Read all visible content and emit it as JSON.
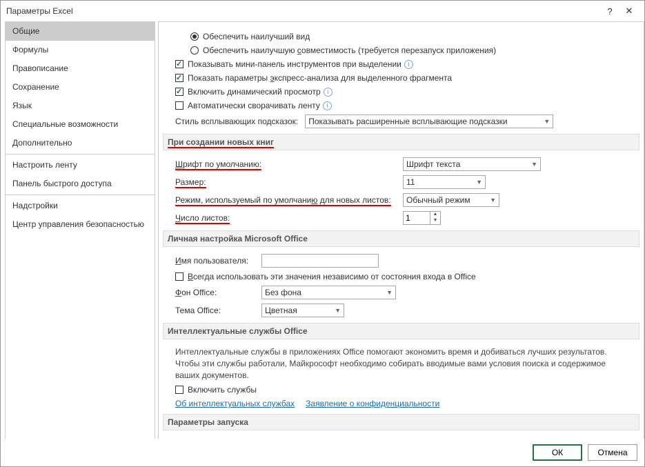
{
  "title": "Параметры Excel",
  "sidebar": {
    "items": [
      {
        "label": "Общие",
        "selected": true
      },
      {
        "label": "Формулы"
      },
      {
        "label": "Правописание"
      },
      {
        "label": "Сохранение"
      },
      {
        "label": "Язык"
      },
      {
        "label": "Специальные возможности"
      },
      {
        "label": "Дополнительно"
      },
      {
        "label": "Настроить ленту",
        "sep": true
      },
      {
        "label": "Панель быстрого доступа"
      },
      {
        "label": "Надстройки",
        "sep": true
      },
      {
        "label": "Центр управления безопасностью"
      }
    ]
  },
  "radios": {
    "best_view": "Обеспечить наилучший вид",
    "best_compat": "Обеспечить наилучшую совместимость (требуется перезапуск приложения)"
  },
  "checks": {
    "mini_toolbar": "Показывать мини-панель инструментов при выделении",
    "quick_analysis": "Показать параметры экспресс-анализа для выделенного фрагмента",
    "live_preview": "Включить динамический просмотр",
    "collapse_ribbon": "Автоматически сворачивать ленту"
  },
  "tooltip_label": "Стиль всплывающих подсказок:",
  "tooltip_value": "Показывать расширенные всплывающие подсказки",
  "sec_newbook": "При создании новых книг",
  "newbook": {
    "font_label": "Шрифт по умолчанию:",
    "font_value": "Шрифт текста",
    "size_label": "Размер:",
    "size_value": "11",
    "mode_label": "Режим, используемый по умолчанию для новых листов:",
    "mode_value": "Обычный режим",
    "sheets_label": "Число листов:",
    "sheets_value": "1"
  },
  "sec_personal": "Личная настройка Microsoft Office",
  "personal": {
    "username_label": "Имя пользователя:",
    "always_use": "Всегда использовать эти значения независимо от состояния входа в Office",
    "bg_label": "Фон Office:",
    "bg_value": "Без фона",
    "theme_label": "Тема Office:",
    "theme_value": "Цветная"
  },
  "sec_intel": "Интеллектуальные службы Office",
  "intel": {
    "desc": "Интеллектуальные службы в приложениях Office помогают экономить время и добиваться лучших результатов. Чтобы эти службы работали, Майкрософт необходимо собирать вводимые вами условия поиска и содержимое ваших документов.",
    "enable": "Включить службы",
    "about_link": "Об интеллектуальных службах",
    "privacy_link": "Заявление о конфиденциальности"
  },
  "sec_startup": "Параметры запуска",
  "footer": {
    "ok": "ОК",
    "cancel": "Отмена"
  }
}
